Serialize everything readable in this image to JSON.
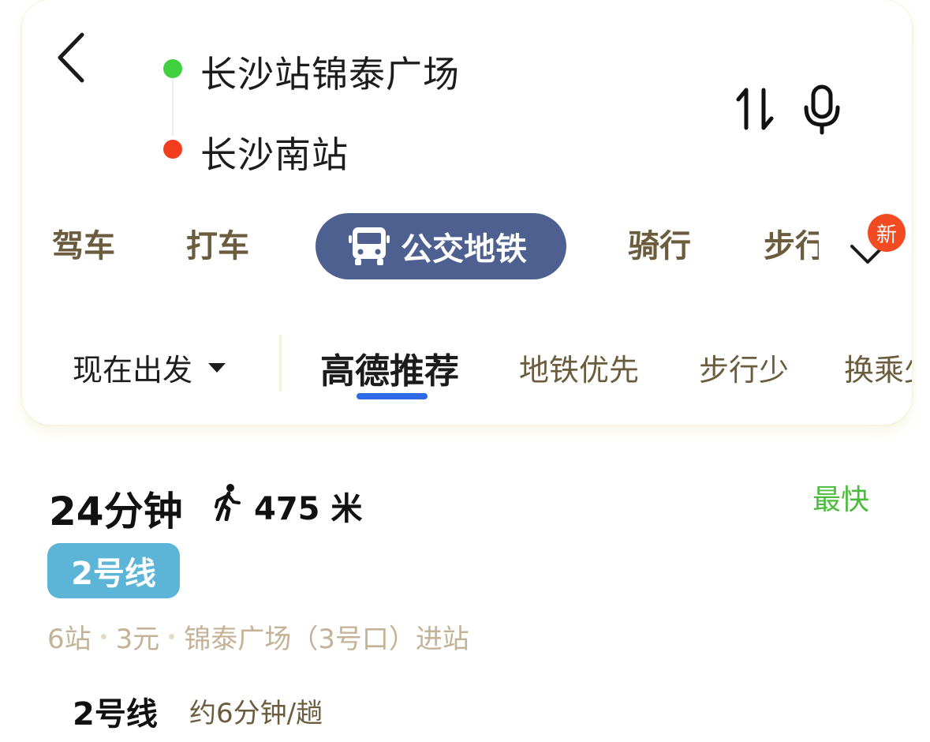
{
  "header": {
    "origin": "长沙站锦泰广场",
    "destination": "长沙南站",
    "icons": {
      "back": "back-arrow-icon",
      "swap": "swap-icon",
      "voice": "microphone-icon"
    },
    "colors": {
      "origin_dot": "#3fd13f",
      "destination_dot": "#f23d1f"
    }
  },
  "modes": {
    "items": [
      {
        "label": "驾车",
        "active": false
      },
      {
        "label": "打车",
        "active": false
      },
      {
        "label": "公交地铁",
        "active": true,
        "icon": "bus-icon"
      },
      {
        "label": "骑行",
        "active": false
      },
      {
        "label": "步行",
        "active": false
      }
    ],
    "new_badge": "新",
    "active_color": "#4e6090"
  },
  "filters": {
    "depart_time": "现在出发",
    "tabs": [
      {
        "label": "高德推荐",
        "active": true
      },
      {
        "label": "地铁优先",
        "active": false
      },
      {
        "label": "步行少",
        "active": false
      },
      {
        "label": "换乘少",
        "active": false
      }
    ],
    "underline_color": "#2e6ae6"
  },
  "result": {
    "duration": "24分钟",
    "walk_distance": "475 米",
    "tag": "最快",
    "line_badge": "2号线",
    "stops": "6站",
    "fare": "3元",
    "entry": "锦泰广场（3号口）进站",
    "line_name": "2号线",
    "frequency": "约6分钟/趟",
    "colors": {
      "tag": "#4cbb3e",
      "line_badge": "#5cb4d6"
    }
  }
}
